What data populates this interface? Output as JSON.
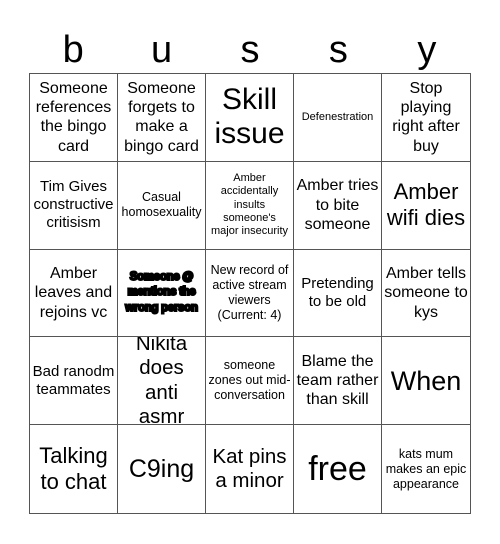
{
  "card": {
    "title_letters": [
      "b",
      "u",
      "s",
      "s",
      "y"
    ],
    "cells": [
      "Someone references the bingo card",
      "Someone forgets to make a bingo card",
      "Skill issue",
      "Defenestration",
      "Stop playing right after buy",
      "Tim Gives constructive critisism",
      "Casual homosexuality",
      "Amber accidentally insults someone's major insecurity",
      "Amber tries to bite someone",
      "Amber wifi dies",
      "Amber leaves and rejoins vc",
      "Someone @ mentions the wrong person",
      "New record of active stream viewers (Current: 4)",
      "Pretending to be old",
      "Amber tells someone to kys",
      "Bad ranodm teammates",
      "Nikita does anti asmr",
      "someone zones out mid-conversation",
      "Blame the team rather than skill",
      "When",
      "Talking to chat",
      "C9ing",
      "Kat pins a minor",
      "free",
      "kats mum makes an epic appearance"
    ]
  }
}
